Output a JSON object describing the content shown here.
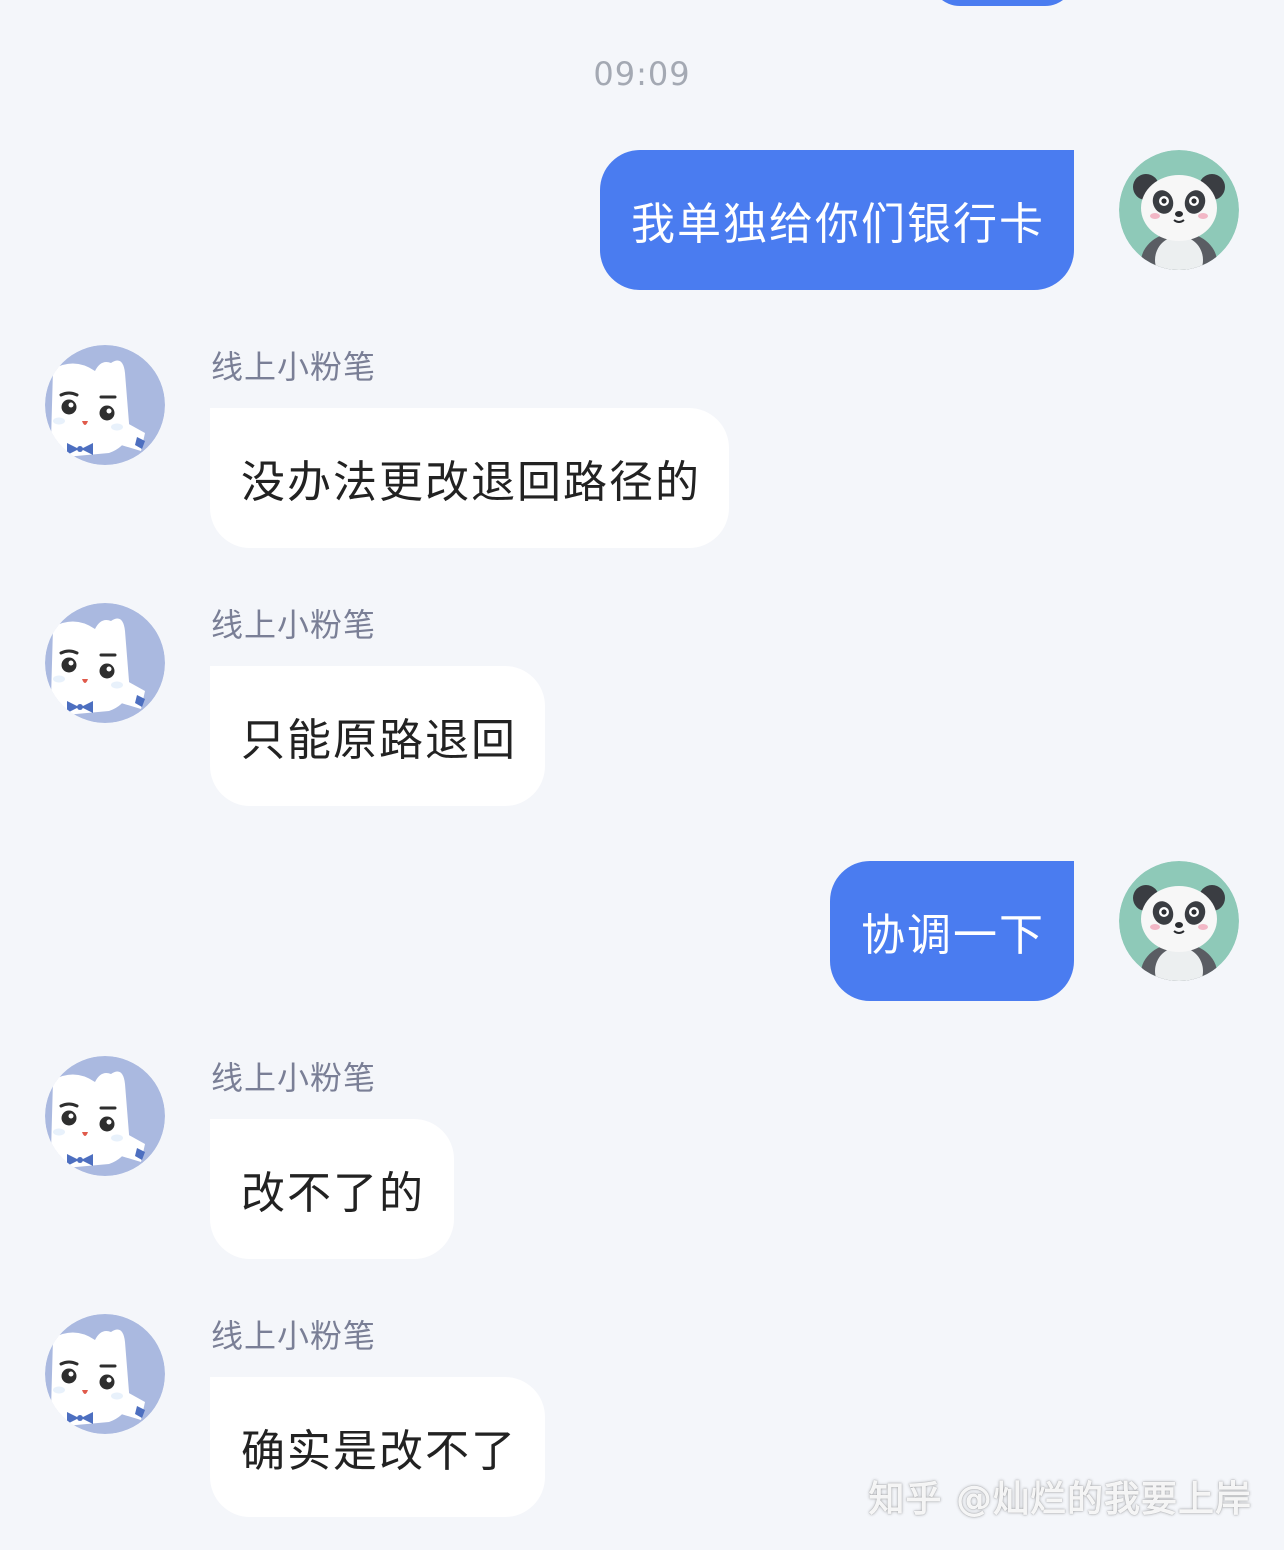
{
  "timestamp": "09:09",
  "messages": [
    {
      "sender": "me",
      "text": "我单独给你们银行卡"
    },
    {
      "sender": "other",
      "name": "线上小粉笔",
      "text": "没办法更改退回路径的"
    },
    {
      "sender": "other",
      "name": "线上小粉笔",
      "text": "只能原路退回"
    },
    {
      "sender": "me",
      "text": "协调一下"
    },
    {
      "sender": "other",
      "name": "线上小粉笔",
      "text": "改不了的"
    },
    {
      "sender": "other",
      "name": "线上小粉笔",
      "text": "确实是改不了"
    }
  ],
  "avatars": {
    "me": "panda-avatar-icon",
    "other": "chalk-mascot-avatar-icon"
  },
  "colors": {
    "background": "#f4f6fa",
    "me_bubble": "#4a7cf0",
    "other_bubble": "#ffffff",
    "sender_name": "#7a7f96",
    "timestamp": "#a4a9b3"
  },
  "watermark": "知乎 @灿烂的我要上岸"
}
